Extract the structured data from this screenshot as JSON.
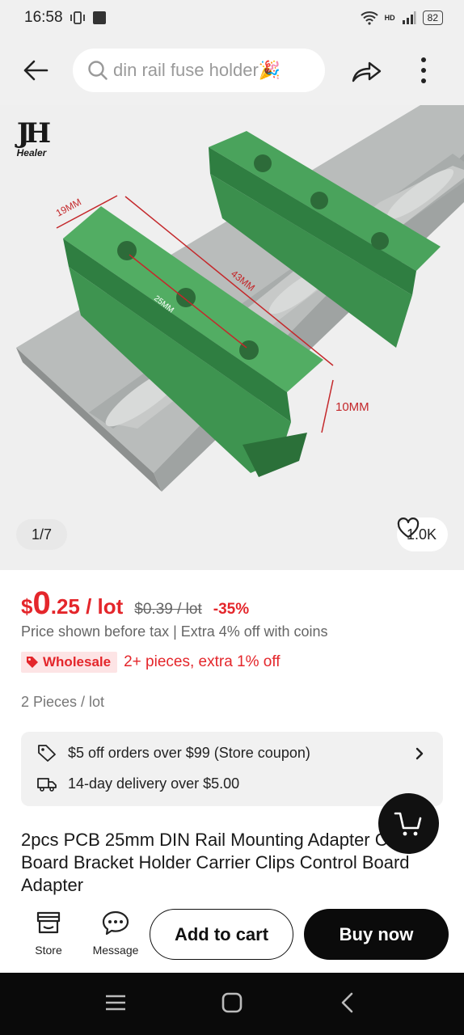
{
  "status_bar": {
    "time": "16:58",
    "battery": "82",
    "net_label": "HD"
  },
  "search": {
    "query": "din rail fuse holder🎉"
  },
  "gallery": {
    "brand_mark": "JH",
    "brand_name": "Healer",
    "page_indicator": "1/7",
    "likes": "1.0K",
    "dimension_labels": [
      "19MM",
      "43MM",
      "25MM",
      "10MM"
    ]
  },
  "price": {
    "currency": "$",
    "integer": "0",
    "decimal": ".25 / lot",
    "original": "$0.39 / lot",
    "discount": "-35%"
  },
  "tax_note": "Price shown before tax | Extra 4% off with coins",
  "wholesale": {
    "badge": "Wholesale",
    "text": "2+ pieces, extra 1% off"
  },
  "pieces": "2 Pieces / lot",
  "info_card": {
    "coupon": "$5 off orders over $99 (Store coupon)",
    "delivery": "14-day delivery over $5.00"
  },
  "title": "2pcs PCB 25mm DIN Rail Mounting Adapter Circuit Board Bracket Holder Carrier Clips Control Board Adapter",
  "actions": {
    "store": "Store",
    "message": "Message",
    "add_to_cart": "Add to cart",
    "buy_now": "Buy now"
  },
  "colors": {
    "accent_red": "#e4262b",
    "dark": "#0b0b0b",
    "part_green": "#3f9a52"
  }
}
